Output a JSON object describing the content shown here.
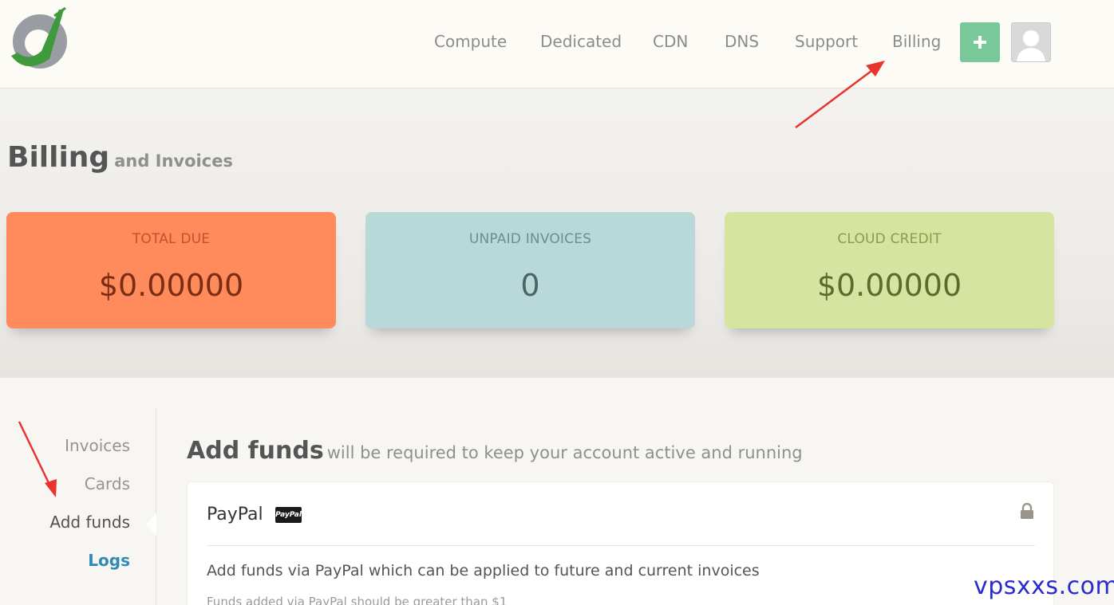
{
  "nav": {
    "items": [
      {
        "label": "Compute"
      },
      {
        "label": "Dedicated"
      },
      {
        "label": "CDN"
      },
      {
        "label": "DNS"
      },
      {
        "label": "Support"
      },
      {
        "label": "Billing"
      }
    ],
    "add_icon": "plus-icon",
    "avatar_icon": "user-avatar-icon"
  },
  "page": {
    "title": "Billing",
    "subtitle": "and Invoices"
  },
  "cards": {
    "total_due": {
      "label": "TOTAL DUE",
      "value": "$0.00000",
      "color": "#ff8b5c"
    },
    "unpaid": {
      "label": "UNPAID INVOICES",
      "value": "0",
      "color": "#b9d9d8"
    },
    "credit": {
      "label": "CLOUD CREDIT",
      "value": "$0.00000",
      "color": "#d5e4a0"
    }
  },
  "sidebar": {
    "items": [
      {
        "label": "Invoices"
      },
      {
        "label": "Cards"
      },
      {
        "label": "Add funds"
      },
      {
        "label": "Logs"
      }
    ],
    "active": "Add funds"
  },
  "section": {
    "title": "Add funds",
    "subtitle": "will be required to keep your account active and running"
  },
  "paypal": {
    "title": "PayPal",
    "badge": "PayPal",
    "lock_icon": "lock-icon",
    "description": "Add funds via PayPal which can be applied to future and current invoices",
    "note": "Funds added via PayPal should be greater than $1"
  },
  "watermark": "vpsxxs.com",
  "colors": {
    "accent_green": "#79c89a",
    "logs_link": "#2f8bb6",
    "annotation_arrow": "#e8332f"
  }
}
